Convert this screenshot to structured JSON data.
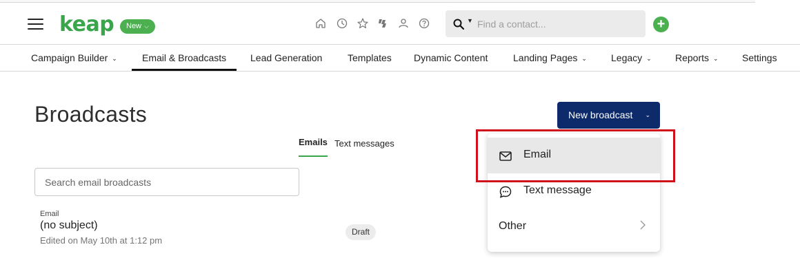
{
  "app": {
    "logo_text": "keap",
    "new_pill_label": "New",
    "brand_color": "#3aa64b",
    "accent_navy": "#0d2b6b",
    "quick_icons": [
      "home-icon",
      "clock-icon",
      "star-icon",
      "lightning-icon",
      "person-icon",
      "help-icon"
    ],
    "search_placeholder": "Find a contact...",
    "add_button_label": "+"
  },
  "nav": {
    "items": [
      {
        "label": "Campaign Builder",
        "dropdown": true,
        "active": false
      },
      {
        "label": "Email & Broadcasts",
        "dropdown": false,
        "active": true
      },
      {
        "label": "Lead Generation",
        "dropdown": false,
        "active": false
      },
      {
        "label": "Templates",
        "dropdown": false,
        "active": false
      },
      {
        "label": "Dynamic Content",
        "dropdown": false,
        "active": false
      },
      {
        "label": "Landing Pages",
        "dropdown": true,
        "active": false
      },
      {
        "label": "Legacy",
        "dropdown": true,
        "active": false
      },
      {
        "label": "Reports",
        "dropdown": true,
        "active": false
      },
      {
        "label": "Settings",
        "dropdown": false,
        "active": false
      }
    ]
  },
  "page": {
    "title": "Broadcasts",
    "tabs": [
      {
        "label": "Emails",
        "active": true
      },
      {
        "label": "Text messages",
        "active": false
      }
    ],
    "search_placeholder": "Search email broadcasts",
    "new_broadcast_label": "New broadcast",
    "broadcasts": [
      {
        "kind": "Email",
        "subject": "(no subject)",
        "edited": "Edited on May 10th at 1:12 pm",
        "status": "Draft"
      }
    ]
  },
  "dropdown_menu": {
    "items": [
      {
        "label": "Email",
        "icon": "mail-icon",
        "highlighted": true
      },
      {
        "label": "Text message",
        "icon": "chat-bubble-icon",
        "highlighted": false
      },
      {
        "label": "Other",
        "icon": "",
        "has_submenu": true,
        "highlighted": false
      }
    ],
    "highlight_color": "#d0111b"
  }
}
